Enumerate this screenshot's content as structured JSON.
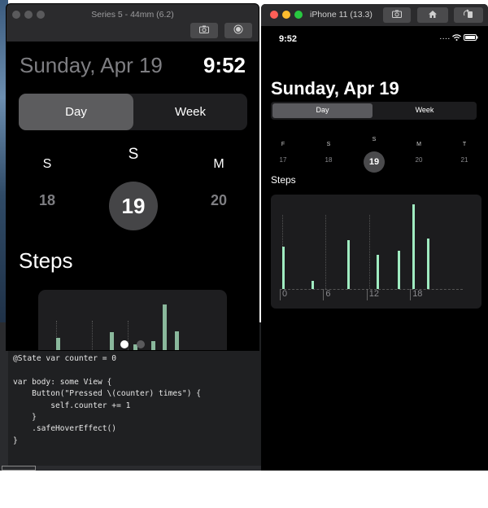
{
  "watch_window": {
    "title": "Series 5 - 44mm (6.2)",
    "toolbar": {
      "screenshot_icon": "camera-icon",
      "home_icon": "record-icon"
    },
    "date": "Sunday, Apr 19",
    "time": "9:52",
    "segments": [
      "Day",
      "Week"
    ],
    "selected_segment": "Day",
    "days": [
      {
        "letter": "S",
        "number": "18"
      },
      {
        "letter": "S",
        "number": "19"
      },
      {
        "letter": "M",
        "number": "20"
      }
    ],
    "selected_day": "19",
    "steps_title": "Steps",
    "page_dots": {
      "count": 2,
      "active": 1
    }
  },
  "phone_window": {
    "title": "iPhone 11 (13.3)",
    "toolbar": [
      "camera-icon",
      "home-icon",
      "rotate-icon"
    ],
    "status_time": "9:52",
    "status_icons": "signal-wifi-battery",
    "date": "Sunday, Apr 19",
    "segments": [
      "Day",
      "Week"
    ],
    "selected_segment": "Day",
    "days": [
      {
        "letter": "F",
        "number": "17"
      },
      {
        "letter": "S",
        "number": "18"
      },
      {
        "letter": "S",
        "number": "19"
      },
      {
        "letter": "M",
        "number": "20"
      },
      {
        "letter": "T",
        "number": "21"
      }
    ],
    "selected_day": "19",
    "steps_title": "Steps",
    "hour_labels": [
      "0",
      "6",
      "12",
      "18"
    ]
  },
  "code_editor": {
    "lines": [
      "@State var counter = 0",
      "",
      "var body: some View {",
      "    Button(\"Pressed \\(counter) times\") {",
      "        self.counter += 1",
      "    }",
      "    .safeHoverEffect()",
      "}"
    ]
  },
  "colors": {
    "bar_watch": "#8ab89c",
    "bar_phone": "#a0ecc1",
    "traffic_red": "#ff5f57",
    "traffic_yellow": "#febc2e",
    "traffic_green": "#28c840",
    "traffic_inactive": "#5a5a5c"
  },
  "chart_data": [
    {
      "type": "bar",
      "title": "Steps",
      "x_ticks": [
        "0",
        "6",
        "12",
        "18"
      ],
      "hours": [
        0,
        4,
        9,
        13,
        16,
        18,
        20
      ],
      "values": [
        50,
        10,
        58,
        40,
        45,
        100,
        60
      ]
    }
  ]
}
